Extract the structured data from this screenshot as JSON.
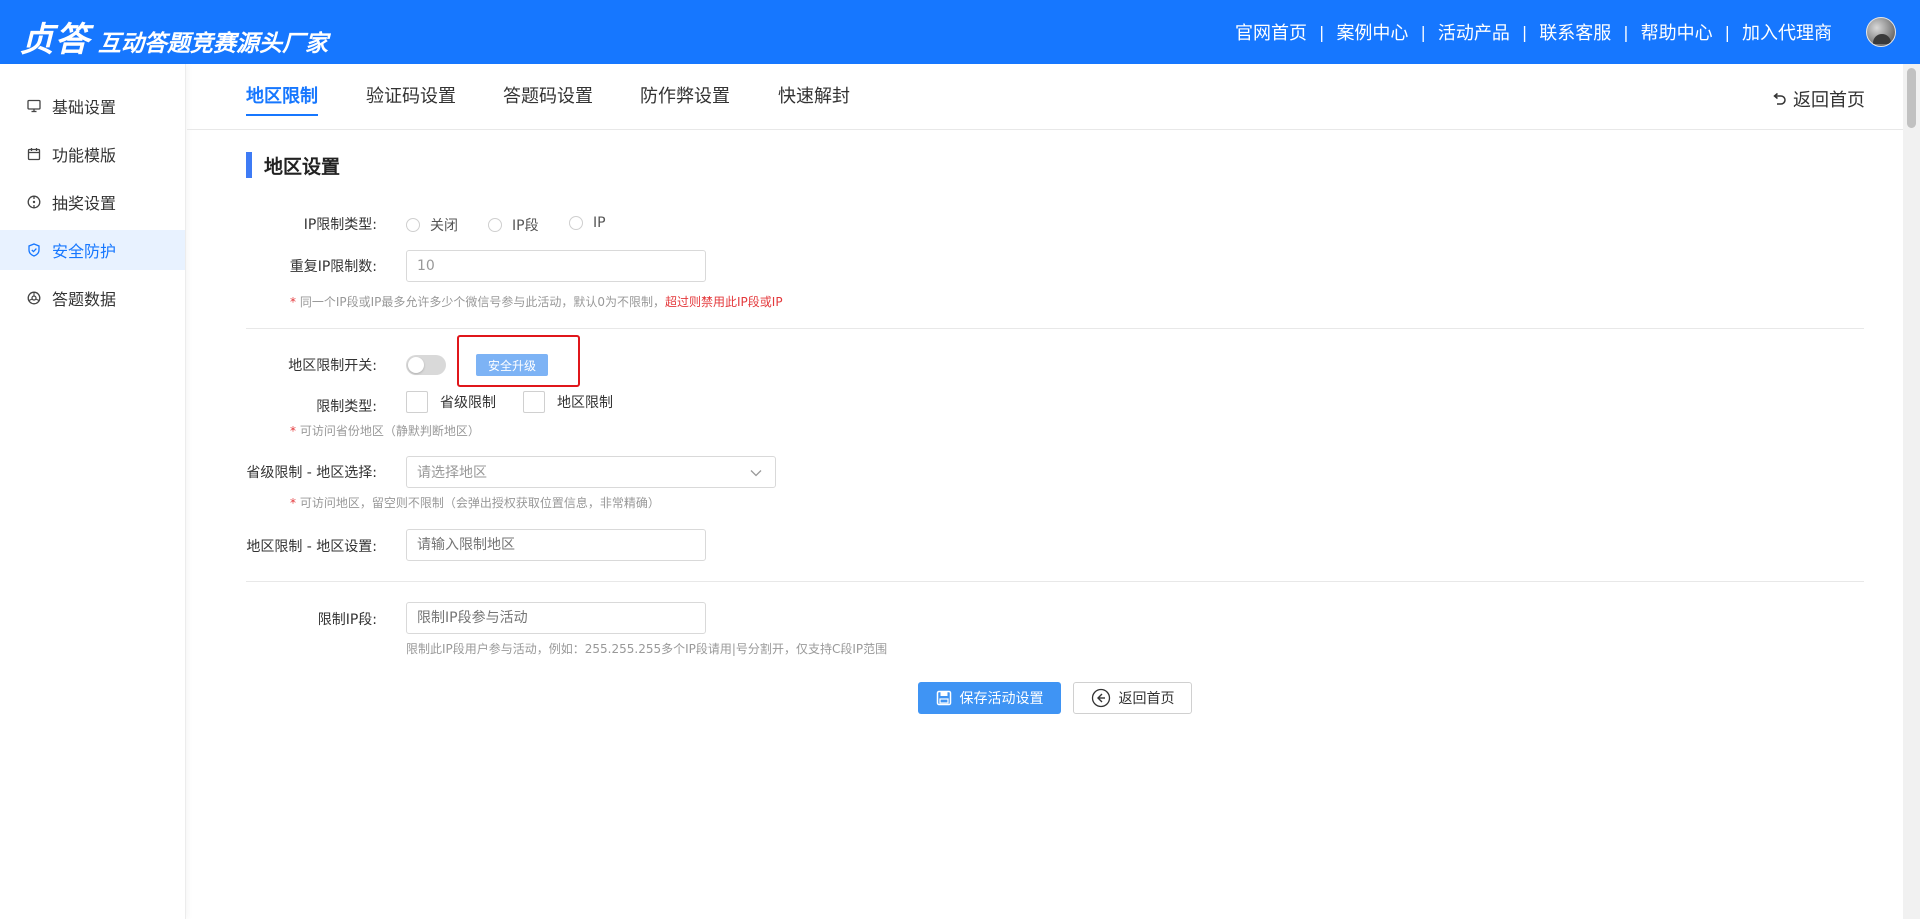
{
  "header": {
    "logo_main": "贞答",
    "logo_sub": "互动答题竞赛源头厂家",
    "nav": [
      "官网首页",
      "案例中心",
      "活动产品",
      "联系客服",
      "帮助中心",
      "加入代理商"
    ],
    "separator": "|"
  },
  "sidebar": {
    "items": [
      {
        "label": "基础设置",
        "icon": "monitor-icon"
      },
      {
        "label": "功能模版",
        "icon": "calendar-icon"
      },
      {
        "label": "抽奖设置",
        "icon": "compass-icon"
      },
      {
        "label": "安全防护",
        "icon": "shield-icon"
      },
      {
        "label": "答题数据",
        "icon": "chart-wheel-icon"
      }
    ],
    "active_index": 3
  },
  "tabs": {
    "items": [
      "地区限制",
      "验证码设置",
      "答题码设置",
      "防作弊设置",
      "快速解封"
    ],
    "active_index": 0,
    "back_home": "返回首页"
  },
  "section": {
    "title": "地区设置"
  },
  "form": {
    "ip_type_label": "IP限制类型:",
    "ip_type_options": [
      "关闭",
      "IP段",
      "IP"
    ],
    "repeat_ip_label": "重复IP限制数:",
    "repeat_ip_value": "10",
    "repeat_ip_hint_star": "*",
    "repeat_ip_hint": " 同一个IP段或IP最多允许多少个微信号参与此活动，默认0为不限制，",
    "repeat_ip_hint_warn": "超过则禁用此IP段或IP",
    "region_switch_label": "地区限制开关:",
    "upgrade_button": "安全升级",
    "limit_type_label": "限制类型:",
    "limit_type_options": [
      "省级限制",
      "地区限制"
    ],
    "limit_type_hint_star": "*",
    "limit_type_hint": " 可访问省份地区（静默判断地区）",
    "province_label": "省级限制 - 地区选择:",
    "province_placeholder": "请选择地区",
    "province_hint_star": "*",
    "province_hint": " 可访问地区，留空则不限制（会弹出授权获取位置信息，非常精确）",
    "region_set_label": "地区限制 - 地区设置:",
    "region_set_placeholder": "请输入限制地区",
    "ip_segment_label": "限制IP段:",
    "ip_segment_placeholder": "限制IP段参与活动",
    "ip_segment_hint": "限制此IP段用户参与活动，例如：255.255.255多个IP段请用|号分割开，仅支持C段IP范围"
  },
  "actions": {
    "save": "保存活动设置",
    "back": "返回首页"
  },
  "colors": {
    "brand": "#1677ff",
    "accent_bar": "#3e7bf5",
    "warn": "#e4393c",
    "highlight_box": "#e0161b"
  }
}
